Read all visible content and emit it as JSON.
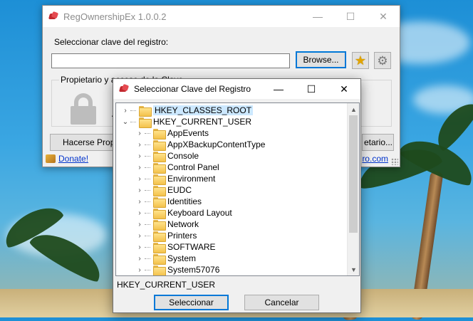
{
  "main_window": {
    "title": "RegOwnershipEx 1.0.0.2",
    "select_key_label": "Seleccionar clave del registro:",
    "path_value": "",
    "browse_label": "Browse...",
    "group_label": "Propietario y acceso de la Clave",
    "group_text_1": "P",
    "group_text_2": "A",
    "take_ownership_label": "Hacerse Propie",
    "restore_owner_label": "etario...",
    "donate_label": "Donate!",
    "site_link": "ro.com",
    "window_controls": {
      "minimize": "—",
      "maximize": "☐",
      "close": "✕"
    }
  },
  "dialog": {
    "title": "Seleccionar Clave del Registro",
    "window_controls": {
      "minimize": "—",
      "maximize": "☐",
      "close": "✕"
    },
    "tree": {
      "roots": [
        {
          "label": "HKEY_CLASSES_ROOT",
          "expanded": false,
          "selected": true
        },
        {
          "label": "HKEY_CURRENT_USER",
          "expanded": true,
          "selected": false
        }
      ],
      "children": [
        "AppEvents",
        "AppXBackupContentType",
        "Console",
        "Control Panel",
        "Environment",
        "EUDC",
        "Identities",
        "Keyboard Layout",
        "Network",
        "Printers",
        "SOFTWARE",
        "System",
        "System57076"
      ]
    },
    "selected_key": "HKEY_CURRENT_USER",
    "select_button": "Seleccionar",
    "cancel_button": "Cancelar"
  },
  "icons": {
    "app": "regedit-cube-icon",
    "favorites": "star-icon",
    "settings": "gear-icon",
    "lock": "lock-icon",
    "donate": "donate-icon",
    "folder": "folder-icon"
  },
  "colors": {
    "link": "#0033cc",
    "selection": "#cce8ff",
    "focus_border": "#0078d7",
    "folder": "#f3c14b"
  }
}
